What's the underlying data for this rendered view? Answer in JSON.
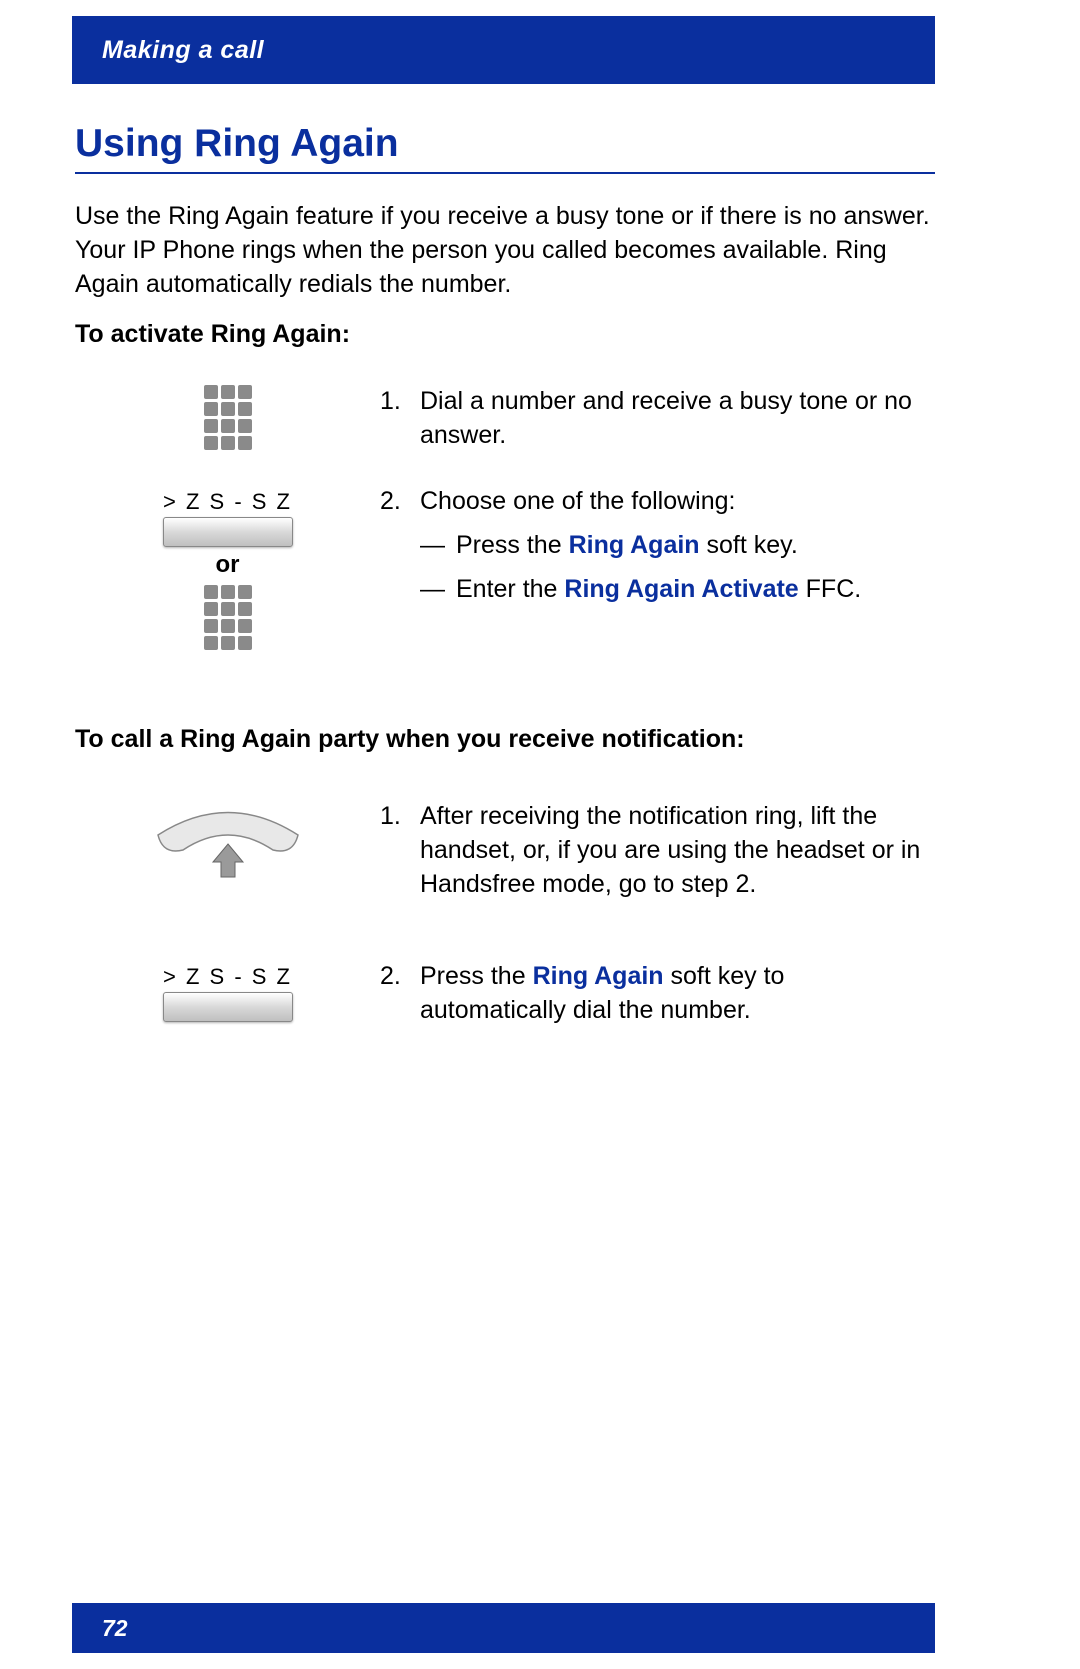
{
  "header": {
    "section_title": "Making a call"
  },
  "title": "Using Ring Again",
  "intro": "Use the Ring Again feature if you receive a busy tone or if there is no answer. Your IP Phone rings when the person you called becomes available. Ring Again automatically redials the number.",
  "subheadings": {
    "activate": "To activate Ring Again:",
    "call_party": "To call a Ring Again party when you receive notification:"
  },
  "steps_activate": {
    "s1": {
      "num": "1.",
      "text": "Dial a number and receive a busy tone or no answer."
    },
    "s2": {
      "num": "2.",
      "intro": "Choose one of the following:",
      "b1_pre": "Press the ",
      "b1_key": "Ring Again",
      "b1_post": " soft key.",
      "b2_pre": "Enter the ",
      "b2_key": "Ring Again Activate",
      "b2_post": " FFC."
    }
  },
  "steps_call": {
    "s1": {
      "num": "1.",
      "text": "After receiving the notification ring, lift the handset, or, if you are using the headset or in Handsfree mode, go to step 2."
    },
    "s2": {
      "num": "2.",
      "pre": "Press the ",
      "key": "Ring Again",
      "post": " soft key to automatically dial the number."
    }
  },
  "labels": {
    "softkey_code": "> Z S - S Z",
    "or": "or",
    "dash": "—"
  },
  "footer": {
    "page_number": "72"
  }
}
